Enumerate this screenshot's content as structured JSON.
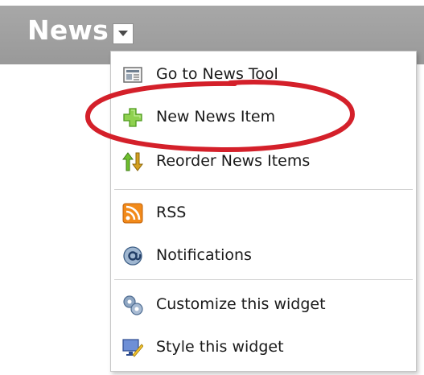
{
  "header": {
    "title": "News",
    "dropdown_icon": "chevron-down-icon"
  },
  "menu": {
    "groups": [
      [
        {
          "label": "Go to News Tool",
          "icon": "news-page-icon"
        },
        {
          "label": "New News Item",
          "icon": "plus-icon"
        },
        {
          "label": "Reorder News Items",
          "icon": "reorder-arrows-icon"
        }
      ],
      [
        {
          "label": "RSS",
          "icon": "rss-icon"
        },
        {
          "label": "Notifications",
          "icon": "at-sign-icon"
        }
      ],
      [
        {
          "label": "Customize this widget",
          "icon": "gears-icon"
        },
        {
          "label": "Style this widget",
          "icon": "monitor-brush-icon"
        }
      ]
    ]
  },
  "annotation": {
    "highlighted_item": "New News Item",
    "color": "#d4202a"
  }
}
